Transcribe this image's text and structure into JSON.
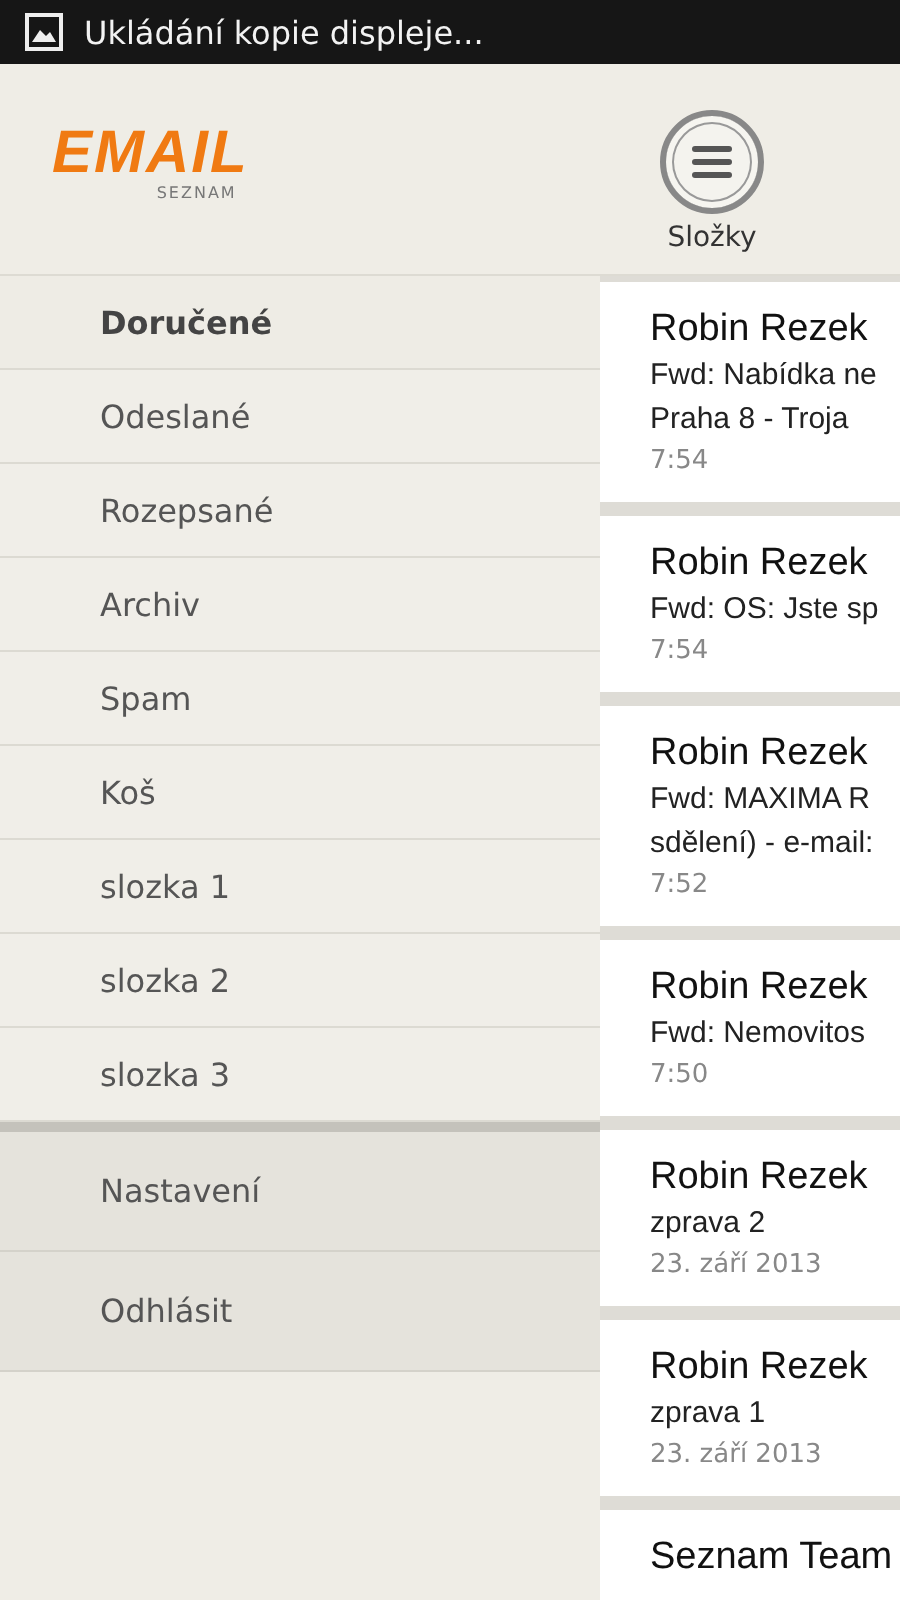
{
  "status_bar": {
    "notification": "Ukládání kopie displeje..."
  },
  "header": {
    "logo": {
      "title": "EMAIL",
      "subtitle": "SEZNAM"
    },
    "folders_button": {
      "label": "Složky"
    }
  },
  "sidebar": {
    "folders": [
      {
        "label": "Doručené",
        "selected": true
      },
      {
        "label": "Odeslané",
        "selected": false
      },
      {
        "label": "Rozepsané",
        "selected": false
      },
      {
        "label": "Archiv",
        "selected": false
      },
      {
        "label": "Spam",
        "selected": false
      },
      {
        "label": "Koš",
        "selected": false
      },
      {
        "label": "slozka 1",
        "selected": false
      },
      {
        "label": "slozka 2",
        "selected": false
      },
      {
        "label": "slozka 3",
        "selected": false
      }
    ],
    "actions": [
      {
        "label": "Nastavení"
      },
      {
        "label": "Odhlásit"
      }
    ]
  },
  "messages": [
    {
      "sender": "Robin Rezek",
      "subject_lines": [
        "Fwd: Nabídka ne",
        "Praha 8 - Troja"
      ],
      "time": "7:54"
    },
    {
      "sender": "Robin Rezek",
      "subject_lines": [
        "Fwd: OS: Jste sp"
      ],
      "time": "7:54"
    },
    {
      "sender": "Robin Rezek",
      "subject_lines": [
        "Fwd: MAXIMA R",
        "sdělení) - e-mail:"
      ],
      "time": "7:52"
    },
    {
      "sender": "Robin Rezek",
      "subject_lines": [
        "Fwd: Nemovitos"
      ],
      "time": "7:50"
    },
    {
      "sender": "Robin Rezek",
      "subject_lines": [
        "zprava 2"
      ],
      "time": "23. září 2013"
    },
    {
      "sender": "Robin Rezek",
      "subject_lines": [
        "zprava 1"
      ],
      "time": "23. září 2013"
    },
    {
      "sender": "Seznam Team"
    }
  ]
}
